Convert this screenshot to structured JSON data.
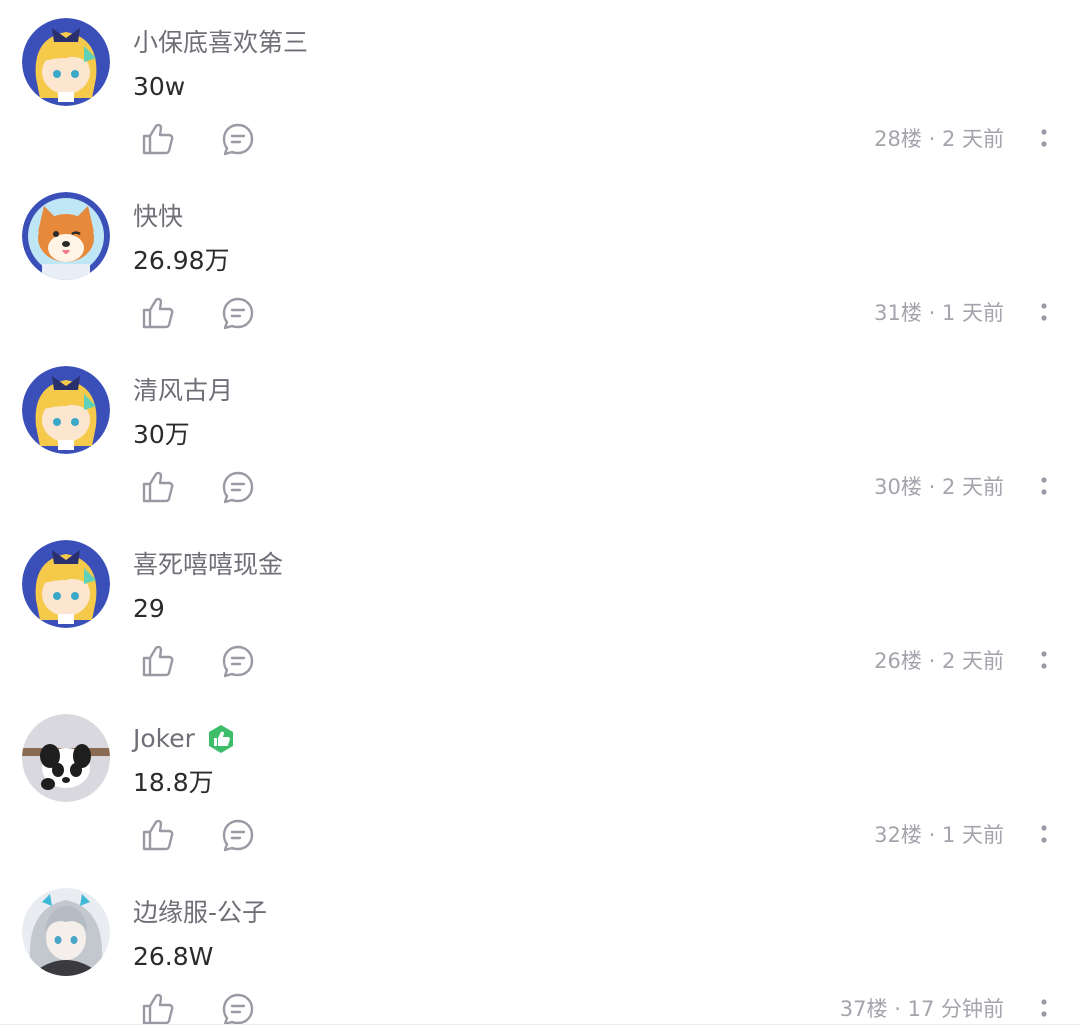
{
  "comments": [
    {
      "username": "小保底喜欢第三",
      "content": "30w",
      "floor": "28楼",
      "separator": "·",
      "time": "2 天前",
      "avatar_icon": "anime-girl-avatar-icon",
      "badge": null
    },
    {
      "username": "快快",
      "content": "26.98万",
      "floor": "31楼",
      "separator": "·",
      "time": "1 天前",
      "avatar_icon": "shiba-dog-avatar-icon",
      "badge": null
    },
    {
      "username": "清风古月",
      "content": "30万",
      "floor": "30楼",
      "separator": "·",
      "time": "2 天前",
      "avatar_icon": "anime-girl-avatar-icon",
      "badge": null
    },
    {
      "username": "喜死嘻嘻现金",
      "content": "29",
      "floor": "26楼",
      "separator": "·",
      "time": "2 天前",
      "avatar_icon": "anime-girl-avatar-icon",
      "badge": null
    },
    {
      "username": "Joker",
      "content": "18.8万",
      "floor": "32楼",
      "separator": "·",
      "time": "1 天前",
      "avatar_icon": "panda-avatar-icon",
      "badge": "green-thumbs-up-badge-icon"
    },
    {
      "username": "边缘服-公子",
      "content": "26.8W",
      "floor": "37楼",
      "separator": "·",
      "time": "17 分钟前",
      "avatar_icon": "silver-hair-anime-avatar-icon",
      "badge": null
    }
  ],
  "colors": {
    "username": "#6f6f78",
    "content": "#2b2b2b",
    "meta": "#a4a4ac",
    "icon": "#9a9aa4",
    "badge_green": "#3dbd6a",
    "avatar_bg_blue": "#3b4fb8"
  }
}
